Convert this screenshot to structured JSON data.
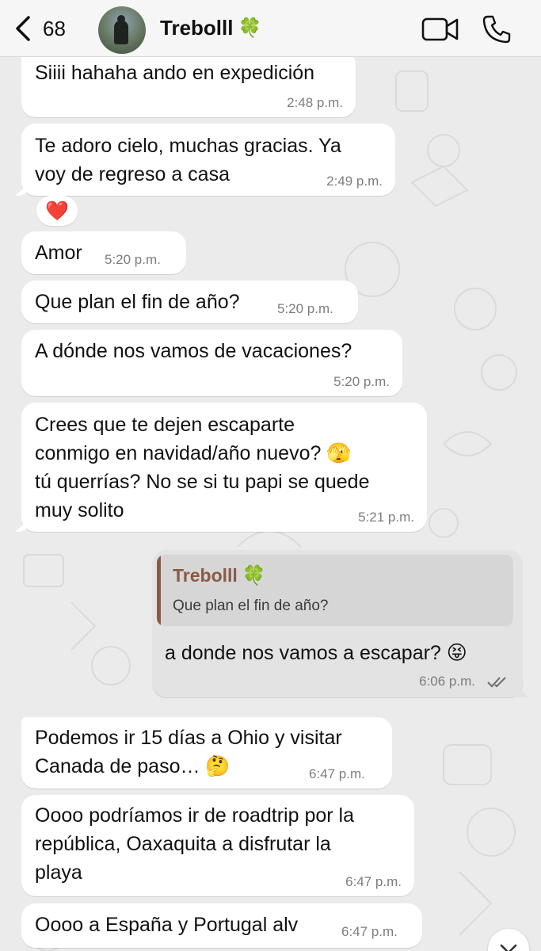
{
  "header": {
    "back_count": "68",
    "contact_name": "Trebolll",
    "clover": "🍀"
  },
  "messages": [
    {
      "text": "Siiii hahaha ando en expedición",
      "time": "2:48 p.m."
    },
    {
      "text_lines": [
        "Te adoro cielo, muchas gracias. Ya",
        "voy de regreso a casa"
      ],
      "time": "2:49 p.m.",
      "reaction": "❤️"
    },
    {
      "text": "Amor",
      "time": "5:20 p.m."
    },
    {
      "text": "Que plan el fin de año?",
      "time": "5:20 p.m."
    },
    {
      "text": "A dónde nos vamos de vacaciones?",
      "time": "5:20 p.m."
    },
    {
      "text_lines": [
        "Crees que te dejen escaparte",
        "conmigo en navidad/año nuevo? 🫣",
        "tú querrías? No se si tu papi se quede",
        "muy solito"
      ],
      "time": "5:21 p.m."
    },
    {
      "outgoing": true,
      "quote_name": "Trebolll",
      "quote_text": "Que plan el fin de año?",
      "text": "a donde nos vamos a escapar? 😝",
      "time": "6:06 p.m."
    },
    {
      "text_lines": [
        "Podemos ir 15 días a Ohio y visitar",
        "Canada de paso… 🤔"
      ],
      "time": "6:47 p.m."
    },
    {
      "text_lines": [
        "Oooo podríamos ir de roadtrip por la",
        "república, Oaxaquita a disfrutar la",
        "playa"
      ],
      "time": "6:47 p.m."
    },
    {
      "text": "Oooo a España y Portugal alv",
      "time": "6:47 p.m."
    }
  ],
  "colors": {
    "incoming_bubble": "#ffffff",
    "outgoing_bubble": "#e3e3e3",
    "quote_accent": "#8a5a44",
    "clover": "#1e9c3a"
  }
}
